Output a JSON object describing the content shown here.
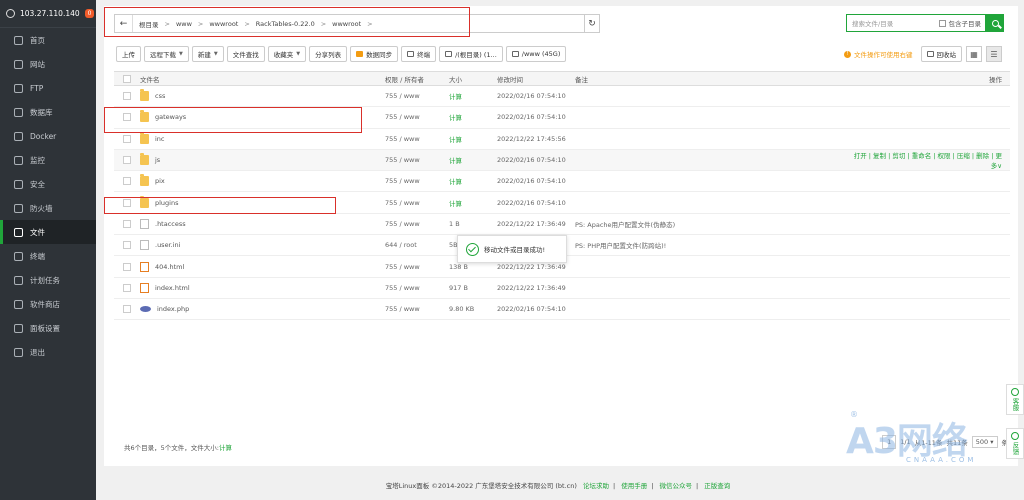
{
  "sidebar": {
    "server_ip": "103.27.110.140",
    "badge": "0",
    "items": [
      {
        "label": "首页",
        "icon": "home-icon"
      },
      {
        "label": "网站",
        "icon": "globe-icon"
      },
      {
        "label": "FTP",
        "icon": "ftp-icon"
      },
      {
        "label": "数据库",
        "icon": "database-icon"
      },
      {
        "label": "Docker",
        "icon": "docker-icon"
      },
      {
        "label": "监控",
        "icon": "monitor-icon"
      },
      {
        "label": "安全",
        "icon": "shield-icon"
      },
      {
        "label": "防火墙",
        "icon": "firewall-icon"
      },
      {
        "label": "文件",
        "icon": "folder-icon"
      },
      {
        "label": "终端",
        "icon": "terminal-icon"
      },
      {
        "label": "计划任务",
        "icon": "clock-icon"
      },
      {
        "label": "软件商店",
        "icon": "apps-icon"
      },
      {
        "label": "面板设置",
        "icon": "settings-icon"
      },
      {
        "label": "退出",
        "icon": "logout-icon"
      }
    ],
    "active_index": 8
  },
  "path": {
    "back": "←",
    "crumbs": [
      "根目录",
      "www",
      "wwwroot",
      "RackTables-0.22.0",
      "wwwroot"
    ]
  },
  "search": {
    "placeholder": "搜索文件/目录",
    "subdir_label": "包含子目录"
  },
  "toolbar": {
    "buttons": [
      "上传",
      "远程下载",
      "新建",
      "文件查找",
      "收藏夹",
      "分享列表",
      "数据同步",
      "终端",
      "/(根目录) (1...",
      "/www (45G)"
    ],
    "warning": "文件操作可使用右键",
    "recycle": "回收站"
  },
  "table": {
    "headers": {
      "name": "文件名",
      "perm": "权限 / 所有者",
      "size": "大小",
      "time": "修改时间",
      "note": "备注",
      "op": "操作"
    },
    "rows": [
      {
        "name": "css",
        "type": "folder",
        "perm": "755 / www",
        "size": "计算",
        "time": "2022/02/16 07:54:10",
        "note": ""
      },
      {
        "name": "gateways",
        "type": "folder",
        "perm": "755 / www",
        "size": "计算",
        "time": "2022/02/16 07:54:10",
        "note": ""
      },
      {
        "name": "inc",
        "type": "folder",
        "perm": "755 / www",
        "size": "计算",
        "time": "2022/12/22 17:45:56",
        "note": ""
      },
      {
        "name": "js",
        "type": "folder",
        "perm": "755 / www",
        "size": "计算",
        "time": "2022/02/16 07:54:10",
        "note": ""
      },
      {
        "name": "pix",
        "type": "folder",
        "perm": "755 / www",
        "size": "计算",
        "time": "2022/02/16 07:54:10",
        "note": ""
      },
      {
        "name": "plugins",
        "type": "folder",
        "perm": "755 / www",
        "size": "计算",
        "time": "2022/02/16 07:54:10",
        "note": ""
      },
      {
        "name": ".htaccess",
        "type": "file",
        "perm": "755 / www",
        "size": "1 B",
        "time": "2022/12/22 17:36:49",
        "note": "PS: Apache用户配置文件(伪静态)"
      },
      {
        "name": ".user.ini",
        "type": "file",
        "perm": "644 / root",
        "size": "5B",
        "time": "2022/12/22 17:36:49",
        "note": "PS: PHP用户配置文件(防跨站)!"
      },
      {
        "name": "404.html",
        "type": "html",
        "perm": "755 / www",
        "size": "138 B",
        "time": "2022/12/22 17:36:49",
        "note": ""
      },
      {
        "name": "index.html",
        "type": "html",
        "perm": "755 / www",
        "size": "917 B",
        "time": "2022/12/22 17:36:49",
        "note": ""
      },
      {
        "name": "index.php",
        "type": "php",
        "perm": "755 / www",
        "size": "9.80 KB",
        "time": "2022/02/16 07:54:10",
        "note": ""
      }
    ],
    "hover_row": 3,
    "row_actions": "打开 | 复制 | 剪切 | 重命名 | 权限 | 压缩 | 删除 | 更多∨"
  },
  "footer": {
    "count_text": "共6个目录，5个文件，文件大小:",
    "count_link": "计算",
    "page_current": "1",
    "page_text": "1/1",
    "range_text": "从1-11条",
    "total_text": "共11条",
    "per_page": "500",
    "per_page_suffix": "条"
  },
  "toast": {
    "message": "移动文件或目录成功!"
  },
  "float_tabs": [
    "客服",
    "反馈"
  ],
  "copyright": {
    "text": "宝塔Linux面板 ©2014-2022 广东堡塔安全技术有限公司 (bt.cn)",
    "links": [
      "论坛求助",
      "使用手册",
      "微信公众号",
      "正版查询"
    ]
  },
  "watermark": {
    "main": "A3网络",
    "sub": "CNAAA.COM",
    "reg": "®"
  },
  "colors": {
    "accent": "#20a53a",
    "sidebar_bg": "#2e3338",
    "highlight": "#d9302a",
    "warning": "#f39c12"
  }
}
